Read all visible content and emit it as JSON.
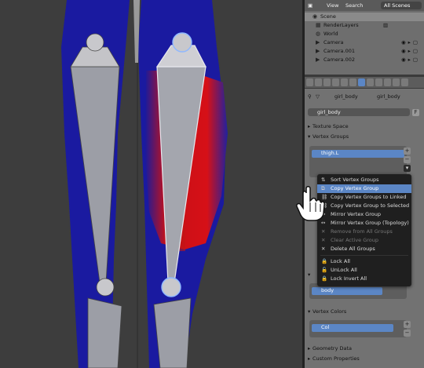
{
  "outliner": {
    "menu": [
      "View",
      "Search"
    ],
    "scene_select": "All Scenes",
    "rows": [
      {
        "label": "Scene",
        "selected": true
      },
      {
        "label": "RenderLayers"
      },
      {
        "label": "World"
      },
      {
        "label": "Camera"
      },
      {
        "label": "Camera.001"
      },
      {
        "label": "Camera.002"
      }
    ]
  },
  "properties": {
    "breadcrumb_1": "girl_body",
    "breadcrumb_2": "girl_body",
    "mesh_name": "girl_body",
    "mesh_flag": "F",
    "sections": {
      "texture_space": "Texture Space",
      "vertex_groups": "Vertex Groups",
      "vertex_colors": "Vertex Colors",
      "geometry_data": "Geometry Data",
      "custom_properties": "Custom Properties"
    },
    "vertex_group_item": "thigh.L",
    "shape_item": "body",
    "color_item": "Col"
  },
  "context_menu": {
    "items": [
      {
        "label": "Sort Vertex Groups",
        "glyph": "sort-icon"
      },
      {
        "label": "Copy Vertex Group",
        "glyph": "copy-icon",
        "highlighted": true
      },
      {
        "label": "Copy Vertex Groups to Linked",
        "glyph": "link-icon"
      },
      {
        "label": "Copy Vertex Group to Selected",
        "glyph": "link-icon"
      },
      {
        "label": "Mirror Vertex Group",
        "glyph": "mirror-icon"
      },
      {
        "label": "Mirror Vertex Group (Topology)",
        "glyph": "mirror-icon"
      },
      {
        "label": "Remove from All Groups",
        "glyph": "x-icon",
        "disabled": true
      },
      {
        "label": "Clear Active Group",
        "glyph": "x-icon",
        "disabled": true
      },
      {
        "label": "Delete All Groups",
        "glyph": "x-icon"
      },
      {
        "label": "Lock All",
        "glyph": "lock-icon"
      },
      {
        "label": "UnLock All",
        "glyph": "unlock-icon"
      },
      {
        "label": "Lock Invert All",
        "glyph": "lock-icon"
      }
    ]
  }
}
